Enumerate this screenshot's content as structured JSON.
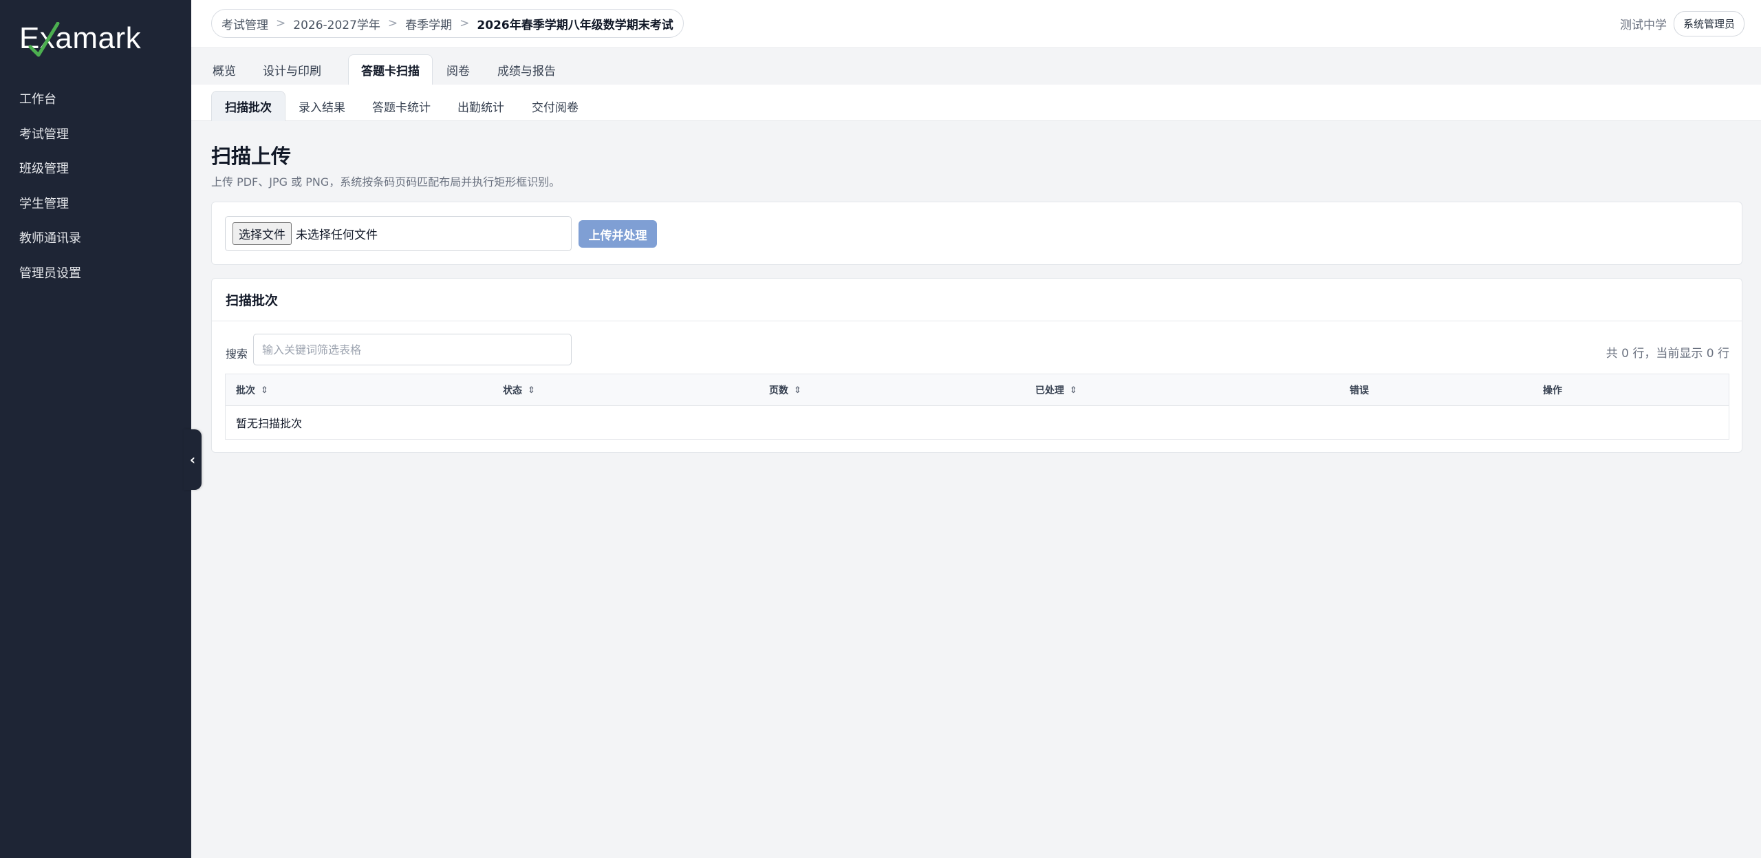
{
  "app": {
    "logo_text": "Examark"
  },
  "sidebar": {
    "items": [
      {
        "label": "工作台"
      },
      {
        "label": "考试管理"
      },
      {
        "label": "班级管理"
      },
      {
        "label": "学生管理"
      },
      {
        "label": "教师通讯录"
      },
      {
        "label": "管理员设置"
      }
    ],
    "collapse_glyph": "‹"
  },
  "breadcrumb": {
    "items": [
      "考试管理",
      "2026-2027学年",
      "春季学期"
    ],
    "current": "2026年春季学期八年级数学期末考试",
    "separator": ">"
  },
  "user": {
    "school": "测试中学",
    "role": "系统管理员"
  },
  "tabs": [
    {
      "label": "概览"
    },
    {
      "label": "设计与印刷"
    },
    {
      "label": "答题卡扫描",
      "active": true
    },
    {
      "label": "阅卷"
    },
    {
      "label": "成绩与报告"
    }
  ],
  "subtabs": [
    {
      "label": "扫描批次",
      "active": true
    },
    {
      "label": "录入结果"
    },
    {
      "label": "答题卡统计"
    },
    {
      "label": "出勤统计"
    },
    {
      "label": "交付阅卷"
    }
  ],
  "page": {
    "title": "扫描上传",
    "subtitle": "上传 PDF、JPG 或 PNG，系统按条码页码匹配布局并执行矩形框识别。"
  },
  "upload": {
    "file_button": "选择文件",
    "file_status": "未选择任何文件",
    "submit_label": "上传并处理"
  },
  "batches": {
    "heading": "扫描批次",
    "search_label": "搜索",
    "search_placeholder": "输入关键词筛选表格",
    "count_text": "共 0 行，当前显示 0 行",
    "columns": [
      "批次",
      "状态",
      "页数",
      "已处理",
      "错误",
      "操作"
    ],
    "empty_text": "暂无扫描批次"
  },
  "colors": {
    "sidebar_bg": "#1e2535",
    "primary_button": "#7f9fd4",
    "logo_check": "#4caf50"
  }
}
